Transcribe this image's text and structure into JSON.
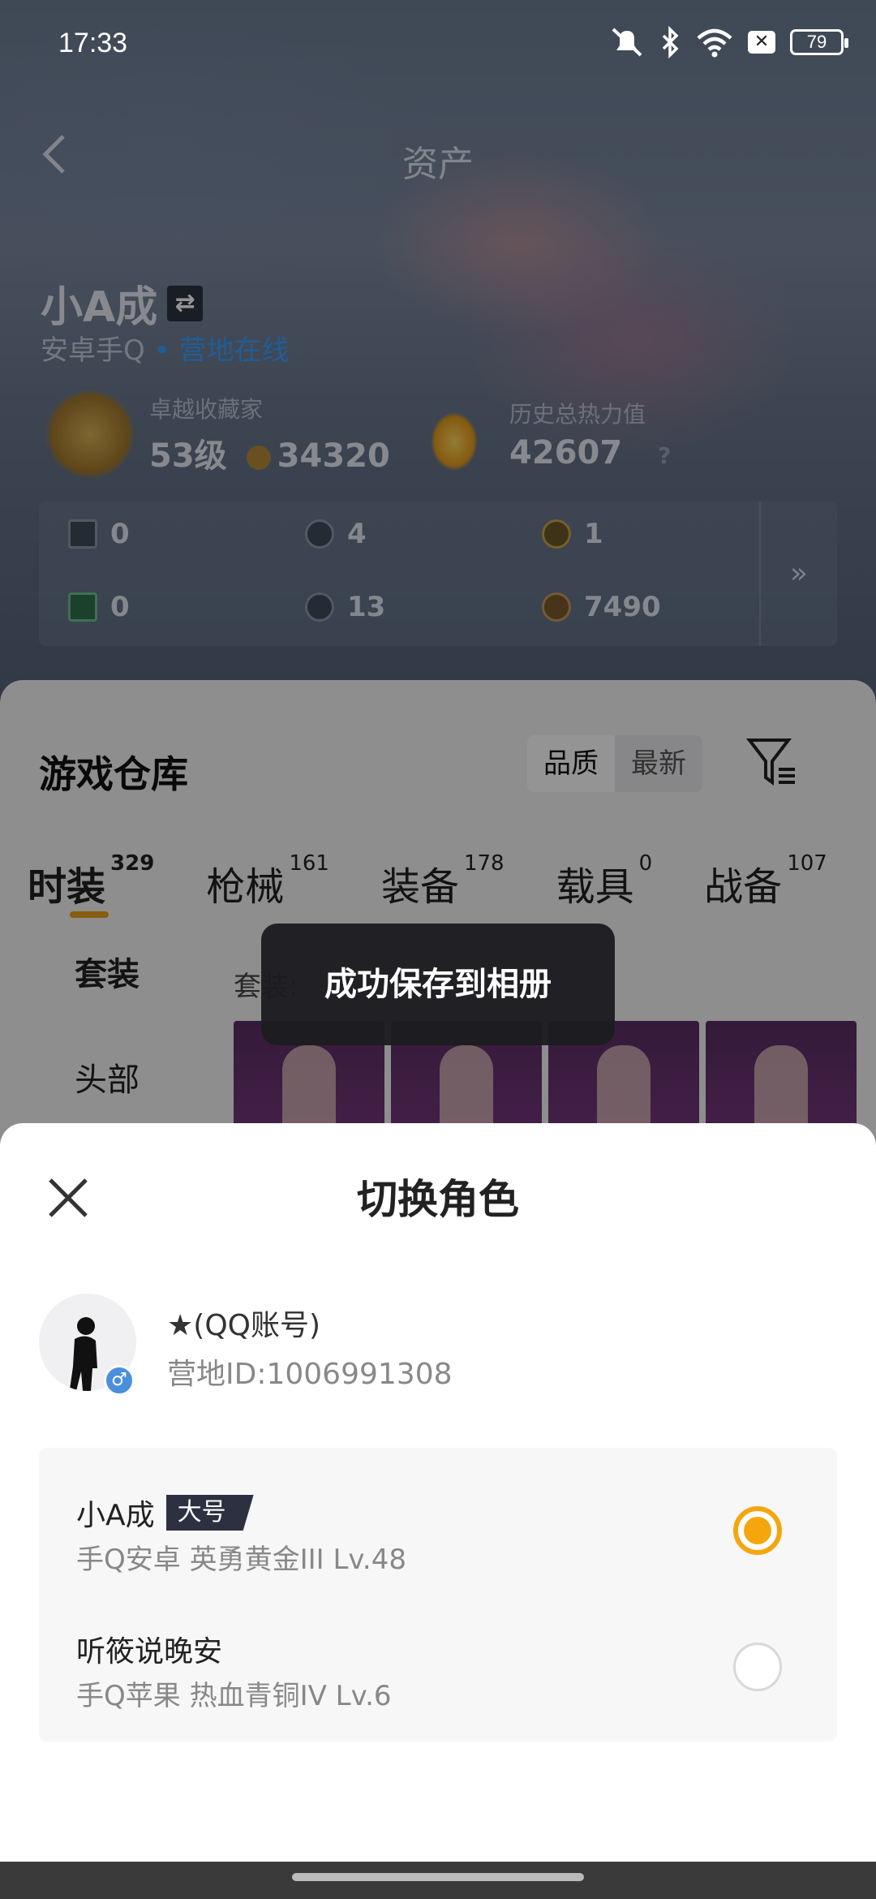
{
  "status_bar": {
    "time": "17:33",
    "battery": "79",
    "x_icon": "✕"
  },
  "nav": {
    "title": "资产"
  },
  "profile": {
    "name": "小A成",
    "platform": "安卓手Q",
    "online_status": "营地在线",
    "badge1_label": "卓越收藏家",
    "badge1_level": "53级",
    "badge1_points": "34320",
    "badge2_label": "历史总热力值",
    "badge2_value": "42607",
    "badge2_help": "?"
  },
  "resources": [
    {
      "icon": "card-icon",
      "value": "0"
    },
    {
      "icon": "s-coin-icon",
      "value": "4"
    },
    {
      "icon": "a-coin-icon",
      "value": "1"
    },
    {
      "icon": "green-card-icon",
      "value": "0"
    },
    {
      "icon": "dark-coin-icon",
      "value": "13"
    },
    {
      "icon": "bronze-coin-icon",
      "value": "7490"
    }
  ],
  "resources_more": "»",
  "warehouse": {
    "title": "游戏仓库",
    "sort_quality": "品质",
    "sort_latest": "最新",
    "tabs": [
      {
        "label": "时装",
        "count": "329"
      },
      {
        "label": "枪械",
        "count": "161"
      },
      {
        "label": "装备",
        "count": "178"
      },
      {
        "label": "载具",
        "count": "0"
      },
      {
        "label": "战备",
        "count": "107"
      }
    ],
    "side": [
      "套装",
      "头部"
    ],
    "section_label": "套装:"
  },
  "toast": "成功保存到相册",
  "sheet": {
    "title": "切换角色",
    "account_name": "★(QQ账号)",
    "account_id": "营地ID:1006991308",
    "gender": "♂",
    "roles": [
      {
        "name": "小A成",
        "tag": "大号",
        "detail": "手Q安卓  英勇黄金III  Lv.48",
        "selected": true
      },
      {
        "name": "听筱说晚安",
        "tag": "",
        "detail": "手Q苹果  热血青铜IV  Lv.6",
        "selected": false
      }
    ]
  },
  "colors": {
    "accent": "#f5a60d",
    "online": "#3aa0ff",
    "tab_underline": "#e8a21b"
  }
}
